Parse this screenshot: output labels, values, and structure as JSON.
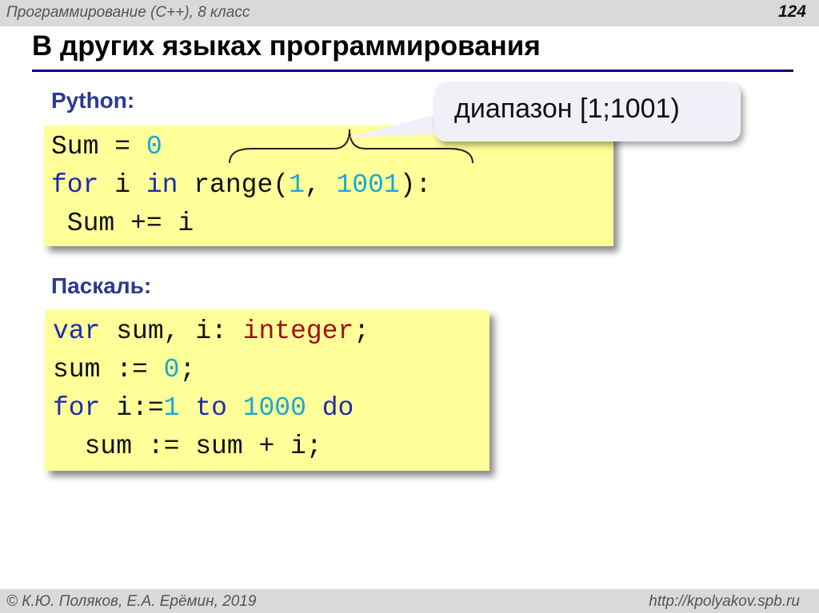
{
  "header": {
    "course": "Программирование (C++), 8 класс",
    "page": "124"
  },
  "slide": {
    "title": "В других языках программирования",
    "python_label": "Python:",
    "pascal_label": "Паскаль:",
    "callout": "диапазон [1;1001)"
  },
  "python_code": [
    [
      {
        "t": "Sum = ",
        "c": "p"
      },
      {
        "t": "0",
        "c": "num"
      }
    ],
    [
      {
        "t": "for",
        "c": "kw"
      },
      {
        "t": " i ",
        "c": "p"
      },
      {
        "t": "in",
        "c": "kw"
      },
      {
        "t": " range(",
        "c": "p"
      },
      {
        "t": "1",
        "c": "num"
      },
      {
        "t": ", ",
        "c": "p"
      },
      {
        "t": "1001",
        "c": "num"
      },
      {
        "t": "):",
        "c": "p"
      }
    ],
    [
      {
        "t": " Sum += i",
        "c": "p"
      }
    ]
  ],
  "pascal_code": [
    [
      {
        "t": "var",
        "c": "kw"
      },
      {
        "t": " sum, i: ",
        "c": "p"
      },
      {
        "t": "integer",
        "c": "typ"
      },
      {
        "t": ";",
        "c": "p"
      }
    ],
    [
      {
        "t": "sum := ",
        "c": "p"
      },
      {
        "t": "0",
        "c": "num"
      },
      {
        "t": ";",
        "c": "p"
      }
    ],
    [
      {
        "t": "for",
        "c": "kw"
      },
      {
        "t": " i:=",
        "c": "p"
      },
      {
        "t": "1",
        "c": "num"
      },
      {
        "t": " ",
        "c": "p"
      },
      {
        "t": "to",
        "c": "kw"
      },
      {
        "t": " ",
        "c": "p"
      },
      {
        "t": "1000",
        "c": "num"
      },
      {
        "t": " ",
        "c": "p"
      },
      {
        "t": "do",
        "c": "kw"
      }
    ],
    [
      {
        "t": "  sum := sum + i;",
        "c": "p"
      }
    ]
  ],
  "footer": {
    "authors": "© К.Ю. Поляков, Е.А. Ерёмин, 2019",
    "website": "http://kpolyakov.spb.ru"
  }
}
